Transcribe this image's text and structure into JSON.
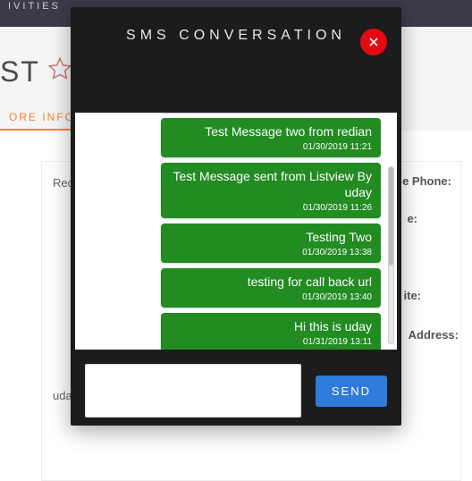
{
  "background": {
    "topbar_text": "IVITIES",
    "title_fragment": "ST",
    "more_info_label": "ORE INFO",
    "record_label_fragment": "Rec",
    "link_text_fragment": "uda",
    "field_labels": {
      "phone": "e Phone:",
      "e_colon": "e:",
      "ite": "ite:",
      "address": "Address:"
    }
  },
  "modal": {
    "title": "SMS CONVERSATION",
    "close_icon": "close-icon",
    "messages": [
      {
        "text": "Test Message two from redian",
        "timestamp": "01/30/2019 11:21"
      },
      {
        "text": "Test Message sent from Listview By uday",
        "timestamp": "01/30/2019 11:26"
      },
      {
        "text": "Testing Two",
        "timestamp": "01/30/2019 13:38"
      },
      {
        "text": "testing for call back url",
        "timestamp": "01/30/2019 13:40"
      },
      {
        "text": "Hi this is uday",
        "timestamp": "01/31/2019 13:11"
      }
    ],
    "compose_value": "",
    "send_label": "SEND"
  },
  "colors": {
    "bubble": "#228b22",
    "send": "#2f7bdc",
    "close": "#e50914",
    "accent": "#fb7f3a"
  }
}
